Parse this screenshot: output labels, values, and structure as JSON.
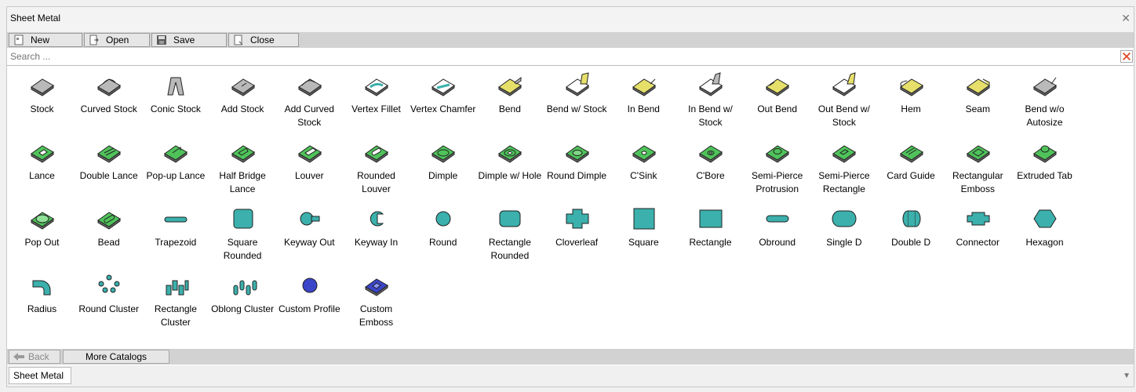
{
  "window": {
    "title": "Sheet Metal"
  },
  "toolbar": {
    "new_label": "New",
    "open_label": "Open",
    "save_label": "Save",
    "close_label": "Close"
  },
  "search": {
    "placeholder": "Search ..."
  },
  "footer": {
    "back_label": "Back",
    "more_label": "More Catalogs"
  },
  "tabs": {
    "active": "Sheet Metal"
  },
  "colors": {
    "accent_green": "#4fc35a",
    "teal": "#3bb0ac",
    "yellow": "#e6e06a",
    "blue": "#3a45c8",
    "gray": "#b9b9b9"
  },
  "items": [
    {
      "label": "Stock",
      "icon": "stock-icon"
    },
    {
      "label": "Curved Stock",
      "icon": "curved-stock-icon"
    },
    {
      "label": "Conic Stock",
      "icon": "conic-stock-icon"
    },
    {
      "label": "Add Stock",
      "icon": "add-stock-icon"
    },
    {
      "label": "Add Curved Stock",
      "icon": "add-curved-stock-icon"
    },
    {
      "label": "Vertex Fillet",
      "icon": "vertex-fillet-icon"
    },
    {
      "label": "Vertex Chamfer",
      "icon": "vertex-chamfer-icon"
    },
    {
      "label": "Bend",
      "icon": "bend-icon"
    },
    {
      "label": "Bend w/ Stock",
      "icon": "bend-with-stock-icon"
    },
    {
      "label": "In Bend",
      "icon": "in-bend-icon"
    },
    {
      "label": "In Bend w/ Stock",
      "icon": "in-bend-with-stock-icon"
    },
    {
      "label": "Out Bend",
      "icon": "out-bend-icon"
    },
    {
      "label": "Out Bend w/ Stock",
      "icon": "out-bend-with-stock-icon"
    },
    {
      "label": "Hem",
      "icon": "hem-icon"
    },
    {
      "label": "Seam",
      "icon": "seam-icon"
    },
    {
      "label": "Bend w/o Autosize",
      "icon": "bend-without-autosize-icon"
    },
    {
      "label": "Lance",
      "icon": "lance-icon"
    },
    {
      "label": "Double Lance",
      "icon": "double-lance-icon"
    },
    {
      "label": "Pop-up Lance",
      "icon": "pop-up-lance-icon"
    },
    {
      "label": "Half Bridge Lance",
      "icon": "half-bridge-lance-icon"
    },
    {
      "label": "Louver",
      "icon": "louver-icon"
    },
    {
      "label": "Rounded Louver",
      "icon": "rounded-louver-icon"
    },
    {
      "label": "Dimple",
      "icon": "dimple-icon"
    },
    {
      "label": "Dimple w/ Hole",
      "icon": "dimple-with-hole-icon"
    },
    {
      "label": "Round Dimple",
      "icon": "round-dimple-icon"
    },
    {
      "label": "C'Sink",
      "icon": "csink-icon"
    },
    {
      "label": "C'Bore",
      "icon": "cbore-icon"
    },
    {
      "label": "Semi-Pierce Protrusion",
      "icon": "semi-pierce-protrusion-icon"
    },
    {
      "label": "Semi-Pierce Rectangle",
      "icon": "semi-pierce-rectangle-icon"
    },
    {
      "label": "Card Guide",
      "icon": "card-guide-icon"
    },
    {
      "label": "Rectangular Emboss",
      "icon": "rectangular-emboss-icon"
    },
    {
      "label": "Extruded Tab",
      "icon": "extruded-tab-icon"
    },
    {
      "label": "Pop Out",
      "icon": "pop-out-icon"
    },
    {
      "label": "Bead",
      "icon": "bead-icon"
    },
    {
      "label": "Trapezoid",
      "icon": "trapezoid-icon"
    },
    {
      "label": "Square Rounded",
      "icon": "square-rounded-icon"
    },
    {
      "label": "Keyway Out",
      "icon": "keyway-out-icon"
    },
    {
      "label": "Keyway In",
      "icon": "keyway-in-icon"
    },
    {
      "label": "Round",
      "icon": "round-icon"
    },
    {
      "label": "Rectangle Rounded",
      "icon": "rectangle-rounded-icon"
    },
    {
      "label": "Cloverleaf",
      "icon": "cloverleaf-icon"
    },
    {
      "label": "Square",
      "icon": "square-icon"
    },
    {
      "label": "Rectangle",
      "icon": "rectangle-icon"
    },
    {
      "label": "Obround",
      "icon": "obround-icon"
    },
    {
      "label": "Single D",
      "icon": "single-d-icon"
    },
    {
      "label": "Double D",
      "icon": "double-d-icon"
    },
    {
      "label": "Connector",
      "icon": "connector-icon"
    },
    {
      "label": "Hexagon",
      "icon": "hexagon-icon"
    },
    {
      "label": "Radius",
      "icon": "radius-icon"
    },
    {
      "label": "Round Cluster",
      "icon": "round-cluster-icon"
    },
    {
      "label": "Rectangle Cluster",
      "icon": "rectangle-cluster-icon"
    },
    {
      "label": "Oblong Cluster",
      "icon": "oblong-cluster-icon"
    },
    {
      "label": "Custom Profile",
      "icon": "custom-profile-icon"
    },
    {
      "label": "Custom Emboss",
      "icon": "custom-emboss-icon"
    }
  ]
}
